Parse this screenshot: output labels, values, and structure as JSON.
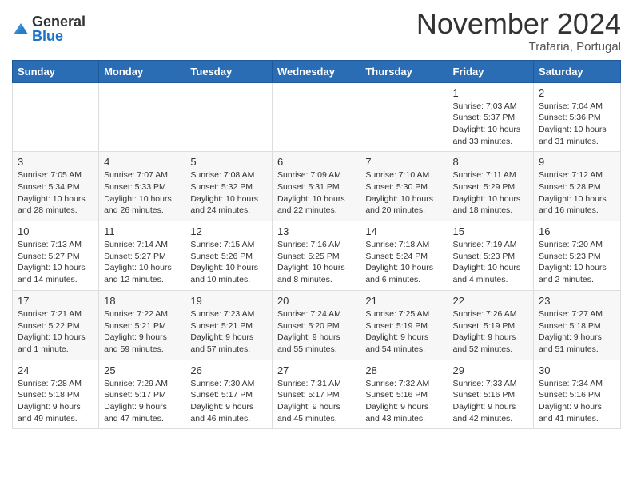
{
  "logo": {
    "general": "General",
    "blue": "Blue"
  },
  "header": {
    "month": "November 2024",
    "location": "Trafaria, Portugal"
  },
  "weekdays": [
    "Sunday",
    "Monday",
    "Tuesday",
    "Wednesday",
    "Thursday",
    "Friday",
    "Saturday"
  ],
  "weeks": [
    [
      {
        "day": "",
        "info": ""
      },
      {
        "day": "",
        "info": ""
      },
      {
        "day": "",
        "info": ""
      },
      {
        "day": "",
        "info": ""
      },
      {
        "day": "",
        "info": ""
      },
      {
        "day": "1",
        "info": "Sunrise: 7:03 AM\nSunset: 5:37 PM\nDaylight: 10 hours and 33 minutes."
      },
      {
        "day": "2",
        "info": "Sunrise: 7:04 AM\nSunset: 5:36 PM\nDaylight: 10 hours and 31 minutes."
      }
    ],
    [
      {
        "day": "3",
        "info": "Sunrise: 7:05 AM\nSunset: 5:34 PM\nDaylight: 10 hours and 28 minutes."
      },
      {
        "day": "4",
        "info": "Sunrise: 7:07 AM\nSunset: 5:33 PM\nDaylight: 10 hours and 26 minutes."
      },
      {
        "day": "5",
        "info": "Sunrise: 7:08 AM\nSunset: 5:32 PM\nDaylight: 10 hours and 24 minutes."
      },
      {
        "day": "6",
        "info": "Sunrise: 7:09 AM\nSunset: 5:31 PM\nDaylight: 10 hours and 22 minutes."
      },
      {
        "day": "7",
        "info": "Sunrise: 7:10 AM\nSunset: 5:30 PM\nDaylight: 10 hours and 20 minutes."
      },
      {
        "day": "8",
        "info": "Sunrise: 7:11 AM\nSunset: 5:29 PM\nDaylight: 10 hours and 18 minutes."
      },
      {
        "day": "9",
        "info": "Sunrise: 7:12 AM\nSunset: 5:28 PM\nDaylight: 10 hours and 16 minutes."
      }
    ],
    [
      {
        "day": "10",
        "info": "Sunrise: 7:13 AM\nSunset: 5:27 PM\nDaylight: 10 hours and 14 minutes."
      },
      {
        "day": "11",
        "info": "Sunrise: 7:14 AM\nSunset: 5:27 PM\nDaylight: 10 hours and 12 minutes."
      },
      {
        "day": "12",
        "info": "Sunrise: 7:15 AM\nSunset: 5:26 PM\nDaylight: 10 hours and 10 minutes."
      },
      {
        "day": "13",
        "info": "Sunrise: 7:16 AM\nSunset: 5:25 PM\nDaylight: 10 hours and 8 minutes."
      },
      {
        "day": "14",
        "info": "Sunrise: 7:18 AM\nSunset: 5:24 PM\nDaylight: 10 hours and 6 minutes."
      },
      {
        "day": "15",
        "info": "Sunrise: 7:19 AM\nSunset: 5:23 PM\nDaylight: 10 hours and 4 minutes."
      },
      {
        "day": "16",
        "info": "Sunrise: 7:20 AM\nSunset: 5:23 PM\nDaylight: 10 hours and 2 minutes."
      }
    ],
    [
      {
        "day": "17",
        "info": "Sunrise: 7:21 AM\nSunset: 5:22 PM\nDaylight: 10 hours and 1 minute."
      },
      {
        "day": "18",
        "info": "Sunrise: 7:22 AM\nSunset: 5:21 PM\nDaylight: 9 hours and 59 minutes."
      },
      {
        "day": "19",
        "info": "Sunrise: 7:23 AM\nSunset: 5:21 PM\nDaylight: 9 hours and 57 minutes."
      },
      {
        "day": "20",
        "info": "Sunrise: 7:24 AM\nSunset: 5:20 PM\nDaylight: 9 hours and 55 minutes."
      },
      {
        "day": "21",
        "info": "Sunrise: 7:25 AM\nSunset: 5:19 PM\nDaylight: 9 hours and 54 minutes."
      },
      {
        "day": "22",
        "info": "Sunrise: 7:26 AM\nSunset: 5:19 PM\nDaylight: 9 hours and 52 minutes."
      },
      {
        "day": "23",
        "info": "Sunrise: 7:27 AM\nSunset: 5:18 PM\nDaylight: 9 hours and 51 minutes."
      }
    ],
    [
      {
        "day": "24",
        "info": "Sunrise: 7:28 AM\nSunset: 5:18 PM\nDaylight: 9 hours and 49 minutes."
      },
      {
        "day": "25",
        "info": "Sunrise: 7:29 AM\nSunset: 5:17 PM\nDaylight: 9 hours and 47 minutes."
      },
      {
        "day": "26",
        "info": "Sunrise: 7:30 AM\nSunset: 5:17 PM\nDaylight: 9 hours and 46 minutes."
      },
      {
        "day": "27",
        "info": "Sunrise: 7:31 AM\nSunset: 5:17 PM\nDaylight: 9 hours and 45 minutes."
      },
      {
        "day": "28",
        "info": "Sunrise: 7:32 AM\nSunset: 5:16 PM\nDaylight: 9 hours and 43 minutes."
      },
      {
        "day": "29",
        "info": "Sunrise: 7:33 AM\nSunset: 5:16 PM\nDaylight: 9 hours and 42 minutes."
      },
      {
        "day": "30",
        "info": "Sunrise: 7:34 AM\nSunset: 5:16 PM\nDaylight: 9 hours and 41 minutes."
      }
    ]
  ]
}
